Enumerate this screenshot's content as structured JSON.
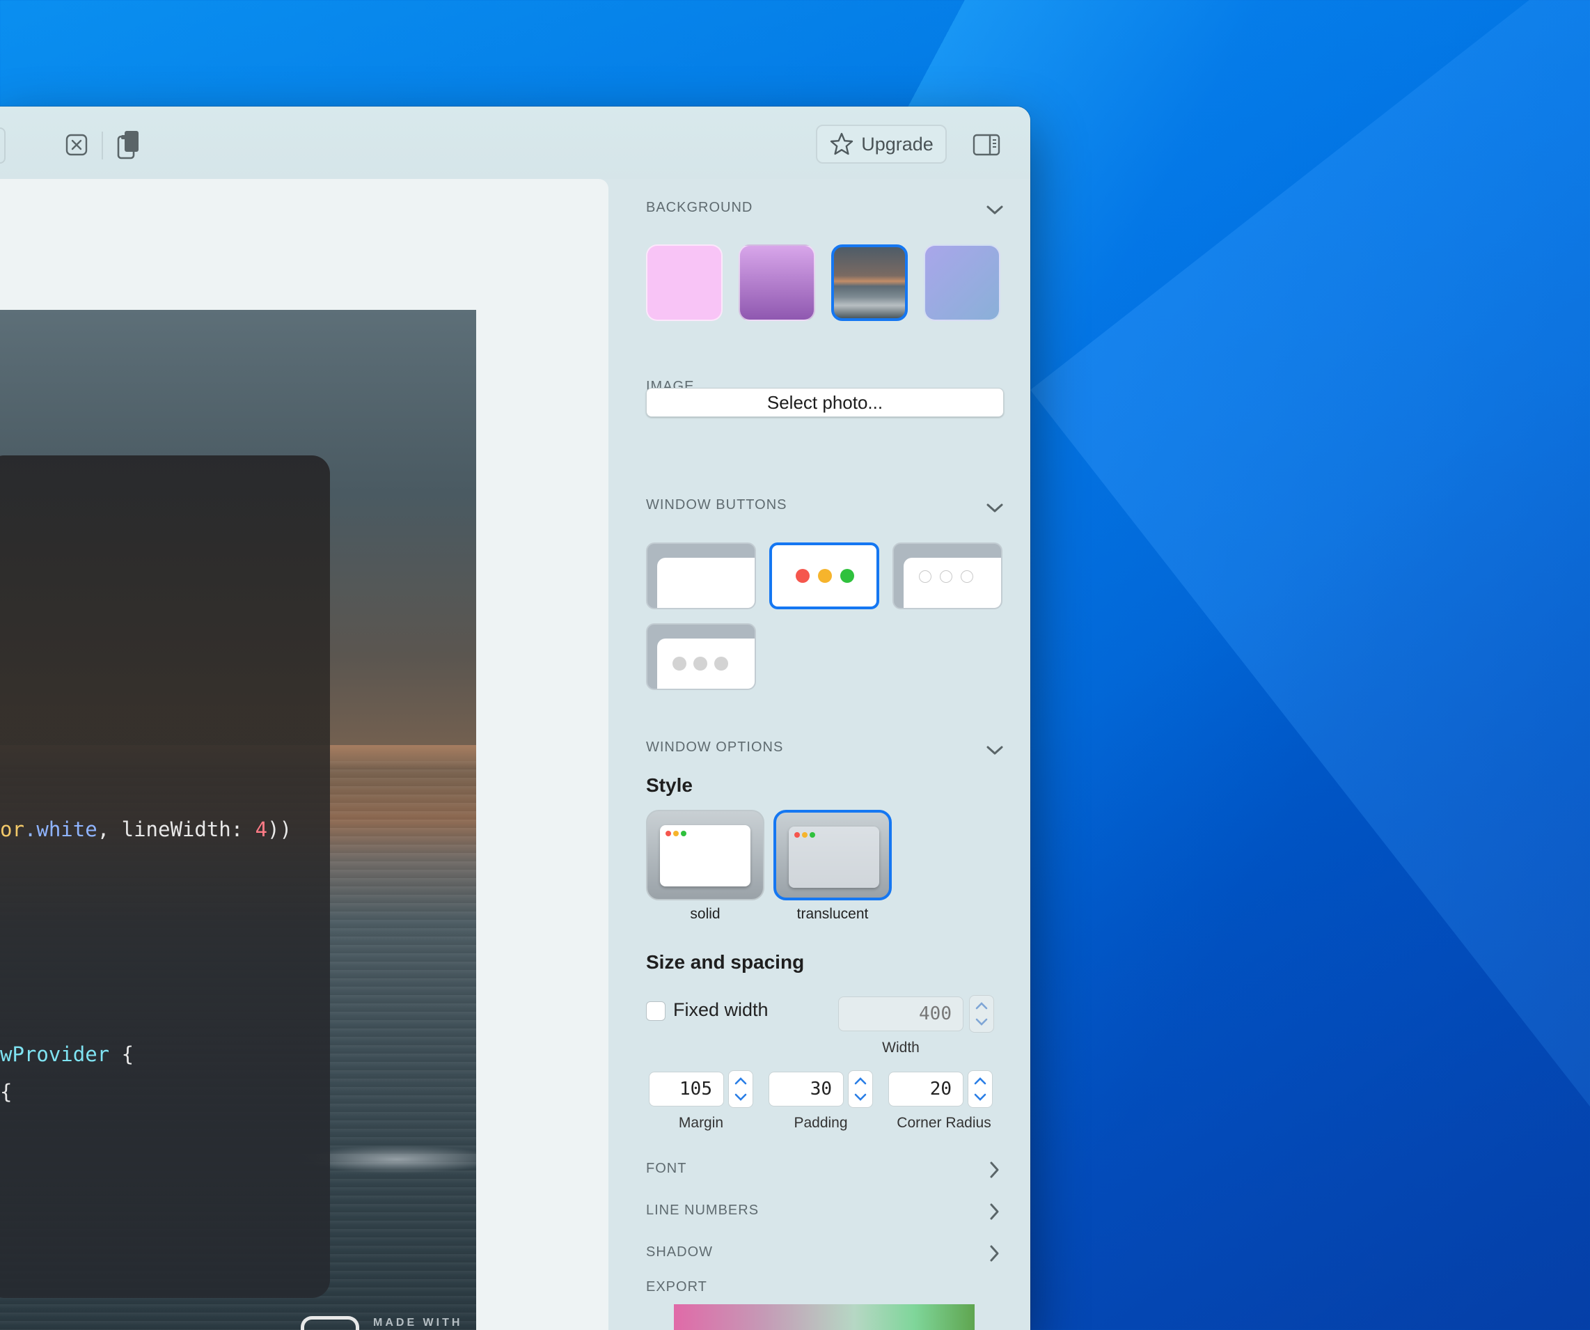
{
  "toolbar": {
    "upgrade_label": "Upgrade"
  },
  "preview": {
    "code_lines": [
      {
        "parts": [
          {
            "t": "or",
            "c": "c-yellow"
          },
          {
            "t": ".white",
            "c": "c-blue"
          },
          {
            "t": ", lineWidth: ",
            "c": "c-white"
          },
          {
            "t": "4",
            "c": "c-red"
          },
          {
            "t": "))",
            "c": "c-white"
          }
        ]
      },
      {
        "parts": [
          {
            "t": "wProvider",
            "c": "c-cyan"
          },
          {
            "t": " {",
            "c": "c-white"
          }
        ]
      },
      {
        "parts": [
          {
            "t": "{",
            "c": "c-white"
          }
        ]
      }
    ],
    "made_with": "MADE WITH"
  },
  "panel": {
    "background": {
      "title": "BACKGROUND",
      "swatches": [
        {
          "name": "pink",
          "color": "#f8c4f6"
        },
        {
          "name": "purple-gradient",
          "color": "#b07cd0"
        },
        {
          "name": "beach-photo",
          "color": "#5a6a74",
          "selected": true
        },
        {
          "name": "lavender-blue",
          "color": "#9aa8e2"
        }
      ]
    },
    "image": {
      "title": "IMAGE",
      "button_label": "Select photo..."
    },
    "window_buttons": {
      "title": "WINDOW BUTTONS",
      "options": [
        "none",
        "colored",
        "outline",
        "gray"
      ],
      "selected": "colored"
    },
    "window_options": {
      "title": "WINDOW OPTIONS",
      "style_heading": "Style",
      "styles": [
        "solid",
        "translucent"
      ],
      "selected_style": "translucent"
    },
    "size_spacing": {
      "heading": "Size and spacing",
      "fixed_width_label": "Fixed width",
      "fixed_width_checked": false,
      "width_value": "400",
      "width_label": "Width",
      "margin_value": "105",
      "margin_label": "Margin",
      "padding_value": "30",
      "padding_label": "Padding",
      "corner_radius_value": "20",
      "corner_radius_label": "Corner Radius"
    },
    "font_label": "FONT",
    "line_numbers_label": "LINE NUMBERS",
    "shadow_label": "SHADOW",
    "export_label": "EXPORT"
  }
}
